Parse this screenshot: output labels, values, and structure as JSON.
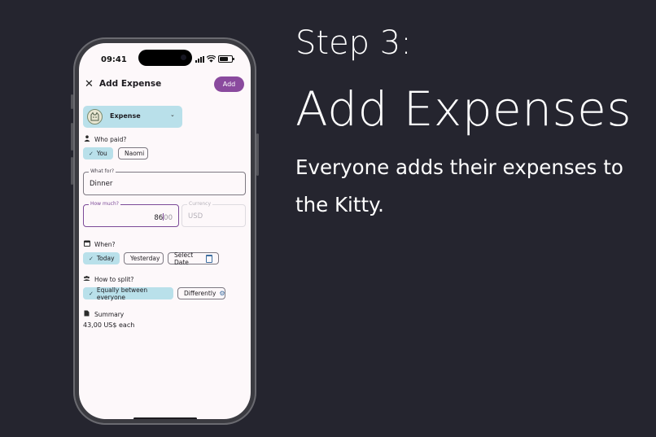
{
  "slide": {
    "step": "Step 3:",
    "headline": "Add Expenses",
    "description": "Everyone adds their expenses to the Kitty."
  },
  "status_bar": {
    "time": "09:41"
  },
  "screen": {
    "title": "Add Expense",
    "add_label": "Add",
    "type_select": {
      "value": "Expense"
    },
    "who_paid": {
      "label": "Who paid?",
      "options": [
        {
          "label": "You",
          "selected": true
        },
        {
          "label": "Naomi",
          "selected": false
        }
      ]
    },
    "what_for": {
      "label": "What for?",
      "value": "Dinner"
    },
    "how_much": {
      "label": "How much?",
      "value": "86",
      "placeholder_decimals": "00"
    },
    "currency": {
      "label": "Currency",
      "value": "USD"
    },
    "when": {
      "label": "When?",
      "options": [
        {
          "label": "Today",
          "selected": true
        },
        {
          "label": "Yesterday",
          "selected": false
        },
        {
          "label": "Select Date",
          "selected": false
        }
      ]
    },
    "split": {
      "label": "How to split?",
      "options": [
        {
          "label": "Equally between everyone",
          "selected": true
        },
        {
          "label": "Differently",
          "selected": false
        }
      ]
    },
    "summary": {
      "label": "Summary",
      "value": "43,00 US$ each"
    }
  },
  "colors": {
    "background": "#25252f",
    "accent": "#8a4a9e",
    "chip_selected": "#b9e0ea"
  },
  "icons": [
    "close-icon",
    "chevron-down-icon",
    "person-icon",
    "calendar-icon",
    "people-icon",
    "document-icon",
    "check-icon",
    "gear-icon",
    "cat-avatar-icon"
  ]
}
